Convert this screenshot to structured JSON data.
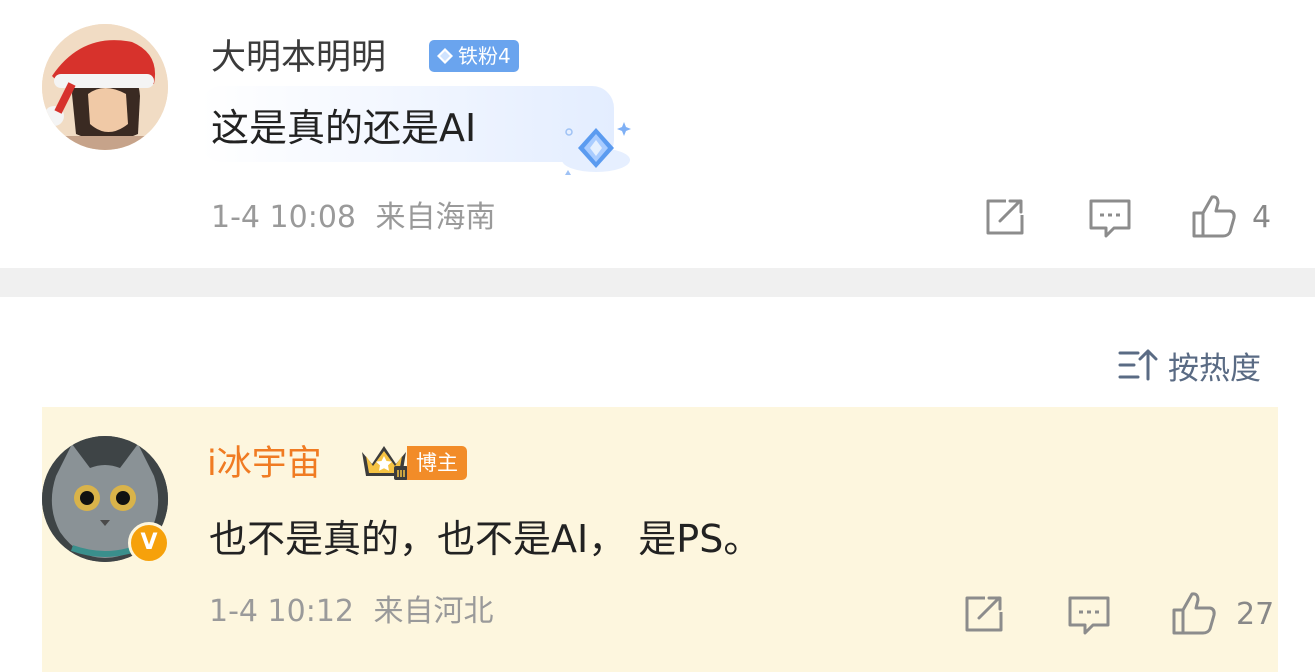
{
  "comments": [
    {
      "username": "大明本明明",
      "badge": "铁粉4",
      "text": "这是真的还是AI",
      "date": "1-4 10:08",
      "location": "来自海南",
      "likes": "4"
    },
    {
      "username": "i冰宇宙",
      "badge": "博主",
      "verified": "V",
      "text": "也不是真的，也不是AI，  是PS。",
      "date": "1-4 10:12",
      "location": "来自河北",
      "likes": "27"
    }
  ],
  "sort": {
    "label": "按热度"
  },
  "colors": {
    "fan_badge": "#6aa4ee",
    "blogger_name": "#f07b22",
    "blogger_badge": "#f28c28",
    "reply_bg": "#fdf6de",
    "meta_text": "#9a9a9a",
    "divider": "#f0f0f0"
  },
  "icons": [
    "share-icon",
    "comment-icon",
    "like-icon",
    "sort-icon",
    "diamond-icon",
    "crown-icon"
  ]
}
